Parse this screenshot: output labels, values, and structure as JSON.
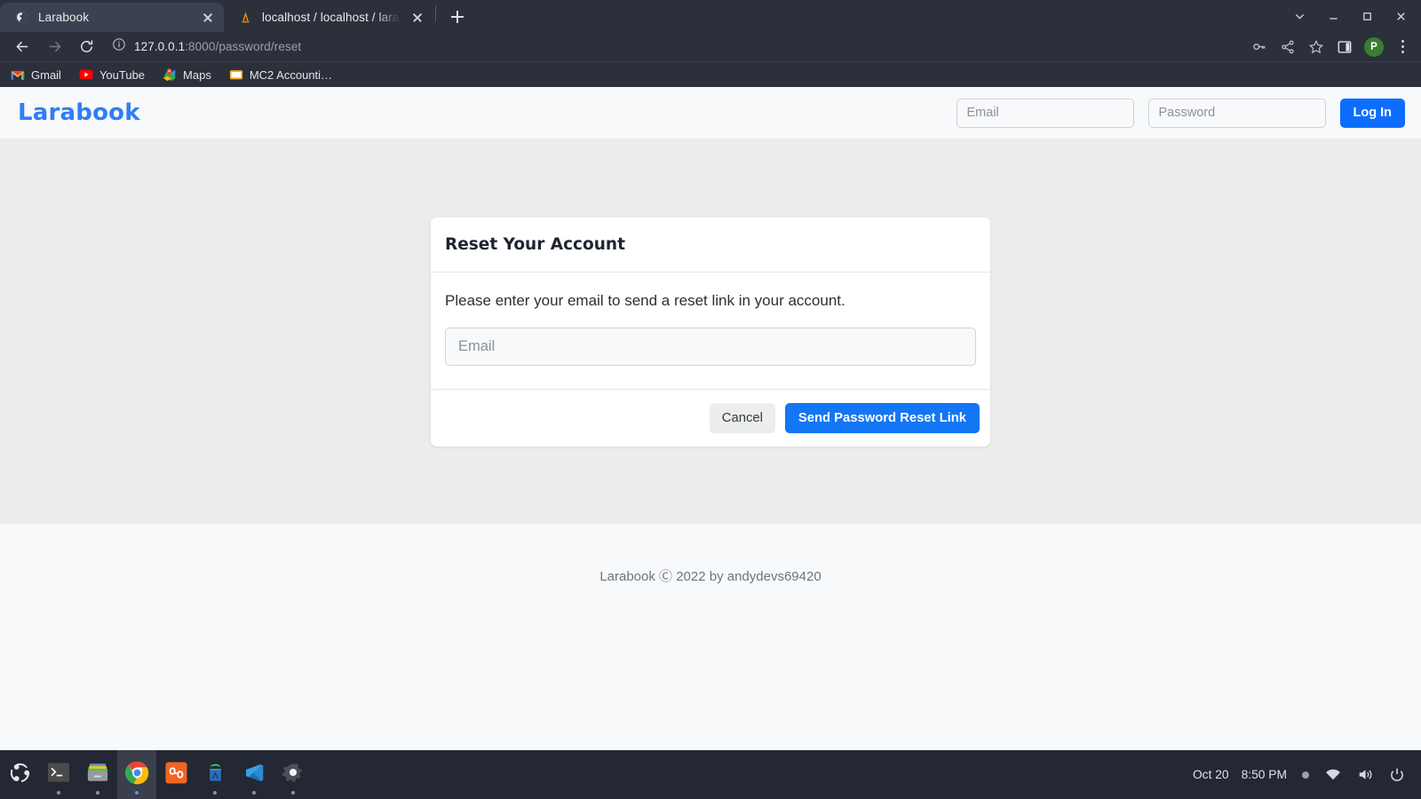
{
  "browser": {
    "tabs": [
      {
        "title": "Larabook",
        "favicon": "globe-icon",
        "active": true
      },
      {
        "title": "localhost / localhost / lara",
        "favicon": "phpmyadmin-icon",
        "active": false
      }
    ],
    "new_tab_label": "+",
    "window_controls": [
      "chevron-down-icon",
      "minimize-icon",
      "maximize-icon",
      "close-icon"
    ],
    "nav": {
      "back": "back-icon",
      "forward": "forward-icon",
      "reload": "reload-icon"
    },
    "address": {
      "info_icon": "info-circle-icon",
      "host": "127.0.0.1",
      "path": ":8000/password/reset"
    },
    "toolbar_icons": [
      "key-icon",
      "share-icon",
      "star-icon",
      "side-panel-icon"
    ],
    "profile_initial": "P",
    "menu_icon": "three-dots-icon",
    "bookmarks": [
      {
        "label": "Gmail",
        "icon": "gmail-icon"
      },
      {
        "label": "YouTube",
        "icon": "youtube-icon"
      },
      {
        "label": "Maps",
        "icon": "maps-icon"
      },
      {
        "label": "MC2 Accounti…",
        "icon": "folder-icon"
      }
    ]
  },
  "site": {
    "brand": "Larabook",
    "header_login": {
      "email_placeholder": "Email",
      "email_value": "",
      "password_placeholder": "Password",
      "password_value": "",
      "login_label": "Log In"
    },
    "card": {
      "title": "Reset Your Account",
      "description": "Please enter your email to send a reset link in your account.",
      "email_placeholder": "Email",
      "email_value": "",
      "cancel_label": "Cancel",
      "submit_label": "Send Password Reset Link"
    },
    "footer_text": "Larabook Ⓒ 2022 by andydevs69420"
  },
  "taskbar": {
    "apps": [
      {
        "name": "ubuntu-dash-icon",
        "active": false,
        "running": false
      },
      {
        "name": "terminal-icon",
        "active": false,
        "running": true
      },
      {
        "name": "files-icon",
        "active": false,
        "running": true
      },
      {
        "name": "chrome-icon",
        "active": true,
        "running": true
      },
      {
        "name": "design-app-icon",
        "active": false,
        "running": false
      },
      {
        "name": "android-studio-icon",
        "active": false,
        "running": true
      },
      {
        "name": "vscode-icon",
        "active": false,
        "running": true
      },
      {
        "name": "settings-icon",
        "active": false,
        "running": true
      }
    ],
    "date": "Oct 20",
    "time": "8:50 PM",
    "tray_icons": [
      "notification-dot-icon",
      "wifi-icon",
      "volume-icon",
      "power-icon"
    ]
  },
  "colors": {
    "brand_blue": "#2f7ef6",
    "button_blue": "#1276f5",
    "page_bg": "#ececec",
    "chrome_bg": "#2b303b",
    "taskbar_bg": "#232834"
  }
}
